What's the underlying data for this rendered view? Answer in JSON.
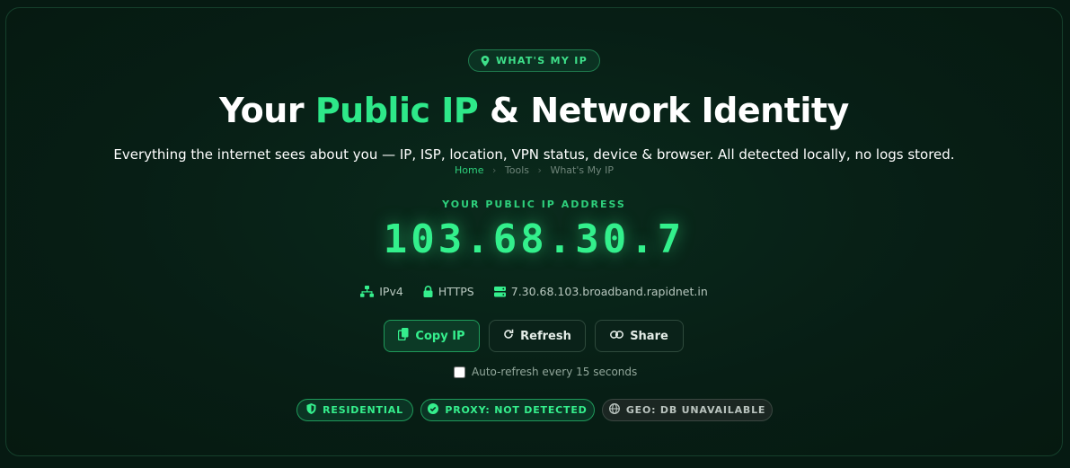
{
  "header_pill": {
    "label": "WHAT'S MY IP",
    "icon": "map-pin-icon"
  },
  "title": {
    "part1": "Your ",
    "accent": "Public IP",
    "part2": " & Network Identity"
  },
  "subtitle": "Everything the internet sees about you — IP, ISP, location, VPN status, device & browser. All detected locally, no logs stored.",
  "breadcrumb": {
    "home": "Home",
    "tools": "Tools",
    "current": "What's My IP"
  },
  "ip_section": {
    "label": "YOUR PUBLIC IP ADDRESS",
    "ip": "103.68.30.7"
  },
  "meta": {
    "version": {
      "icon": "network-icon",
      "text": "IPv4"
    },
    "protocol": {
      "icon": "lock-icon",
      "text": "HTTPS"
    },
    "hostname": {
      "icon": "server-icon",
      "text": "7.30.68.103.broadband.rapidnet.in"
    }
  },
  "actions": {
    "copy": "Copy IP",
    "refresh": "Refresh",
    "share": "Share"
  },
  "auto_refresh": {
    "label": "Auto-refresh every 15 seconds",
    "checked": false
  },
  "tags": {
    "residential": "RESIDENTIAL",
    "proxy": "PROXY: NOT DETECTED",
    "geo": "GEO: DB UNAVAILABLE"
  },
  "colors": {
    "accent": "#2ee889",
    "background": "#061a12",
    "text": "#ffffff",
    "muted": "#93a89c"
  }
}
